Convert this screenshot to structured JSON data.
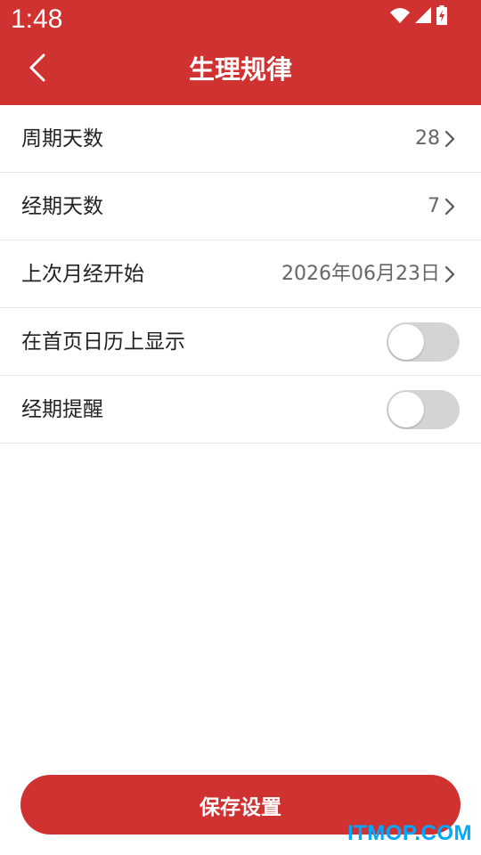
{
  "status_bar": {
    "time": "1:48",
    "icons": [
      "wifi-icon",
      "signal-icon",
      "battery-charging-icon"
    ]
  },
  "header": {
    "title": "生理规律",
    "back_icon": "chevron-left-icon"
  },
  "settings": {
    "rows": [
      {
        "label": "周期天数",
        "value": "28"
      },
      {
        "label": "经期天数",
        "value": "7"
      },
      {
        "label": "上次月经开始",
        "value": "2026年06月23日"
      },
      {
        "label": "在首页日历上显示",
        "toggle_on": false
      },
      {
        "label": "经期提醒",
        "toggle_on": false
      }
    ]
  },
  "footer": {
    "save_label": "保存设置"
  },
  "watermark": {
    "text": "ITMOP.COM"
  },
  "colors": {
    "accent": "#d03232",
    "toggle_off": "#d4d4d4",
    "watermark": "#00a8ff"
  }
}
